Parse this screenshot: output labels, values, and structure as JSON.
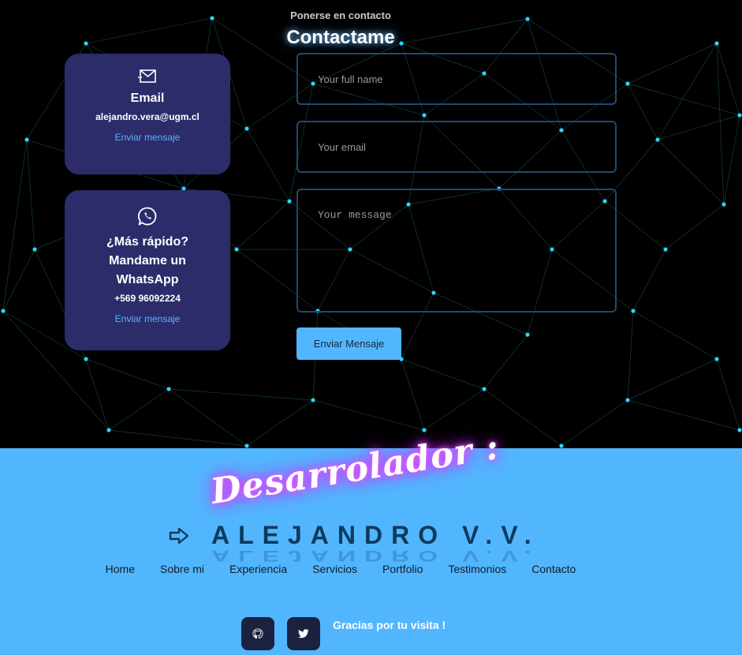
{
  "contact": {
    "subtitle": "Ponerse en contacto",
    "title": "Contactame",
    "cards": {
      "email": {
        "icon": "envelope-icon",
        "title": "Email",
        "value": "alejandro.vera@ugm.cl",
        "link": "Enviar mensaje"
      },
      "whatsapp": {
        "icon": "whatsapp-icon",
        "title": "¿Más rápido? Mandame un WhatsApp",
        "value": "+569 96092224",
        "link": "Enviar mensaje"
      }
    },
    "form": {
      "name_placeholder": "Your full name",
      "email_placeholder": "Your email",
      "message_placeholder": "Your message",
      "submit": "Enviar Mensaje"
    }
  },
  "footer": {
    "tagline": "Desarrolador :",
    "name": "ALEJANDRO V.V.",
    "nav": [
      "Home",
      "Sobre mi",
      "Experiencia",
      "Servicios",
      "Portfolio",
      "Testimonios",
      "Contacto"
    ],
    "social": [
      "github-icon",
      "twitter-icon"
    ],
    "thanks": "Gracias por tu visita !"
  },
  "colors": {
    "background": "#000000",
    "card": "#2c2c6b",
    "accent": "#52b6ff",
    "node": "#2fd3ff",
    "neon": "#e040fb",
    "brand": "#0d3b5e"
  }
}
